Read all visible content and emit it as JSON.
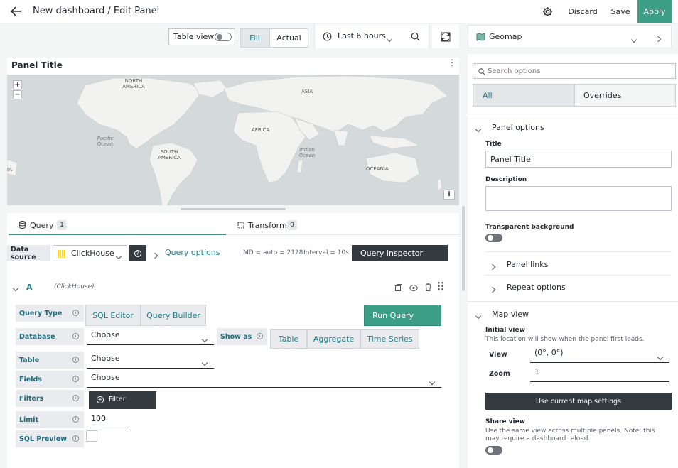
{
  "header": {
    "title": "New dashboard / Edit Panel",
    "discard": "Discard",
    "save": "Save",
    "apply": "Apply"
  },
  "toolbar": {
    "table_view": "Table view",
    "fill": "Fill",
    "actual": "Actual",
    "time_range": "Last 6 hours"
  },
  "viz_picker": {
    "name": "Geomap"
  },
  "panel": {
    "title": "Panel Title",
    "map_labels": {
      "north_america": "NORTH AMERICA",
      "south_america": "SOUTH AMERICA",
      "africa": "AFRICA",
      "asia": "ASIA",
      "oceania": "OCEANIA",
      "pacific": "Pacific Ocean",
      "indian": "Indian Ocean",
      "asia_left": "IA"
    },
    "zoom_in": "+",
    "zoom_out": "−",
    "attribution": "i"
  },
  "tabs": {
    "query_label": "Query",
    "query_count": "1",
    "transform_label": "Transform",
    "transform_count": "0"
  },
  "query_bar": {
    "data_source_label": "Data source",
    "data_source": "ClickHouse",
    "query_options": "Query options",
    "md": "MD = auto = 2128",
    "interval": "Interval = 10s",
    "inspector": "Query inspector"
  },
  "query": {
    "ref": "A",
    "ds": "(ClickHouse)",
    "query_type_label": "Query Type",
    "sql_editor": "SQL Editor",
    "query_builder": "Query Builder",
    "run_query": "Run Query",
    "database_label": "Database",
    "database_value": "Choose",
    "show_as_label": "Show as",
    "show_table": "Table",
    "show_aggregate": "Aggregate",
    "show_timeseries": "Time Series",
    "table_label": "Table",
    "table_value": "Choose",
    "fields_label": "Fields",
    "fields_value": "Choose",
    "filters_label": "Filters",
    "filter_button": "Filter",
    "limit_label": "Limit",
    "limit_value": "100",
    "sql_preview_label": "SQL Preview"
  },
  "options": {
    "search_placeholder": "Search options",
    "tab_all": "All",
    "tab_overrides": "Overrides",
    "panel_options": "Panel options",
    "title_label": "Title",
    "title_value": "Panel Title",
    "description_label": "Description",
    "transparent_label": "Transparent background",
    "panel_links": "Panel links",
    "repeat_options": "Repeat options",
    "map_view": "Map view",
    "initial_view_label": "Initial view",
    "initial_view_hint": "This location will show when the panel first loads.",
    "view_label": "View",
    "view_value": "(0°, 0°)",
    "zoom_label": "Zoom",
    "zoom_value": "1",
    "use_current": "Use current map settings",
    "share_view_label": "Share view",
    "share_view_hint": "Use the same view across multiple panels. Note: this may require a dashboard reload."
  },
  "colors": {
    "accent": "#3d9e87",
    "dark": "#343b40",
    "map_water": "#d4dadc",
    "map_land": "#f2f2f0"
  }
}
